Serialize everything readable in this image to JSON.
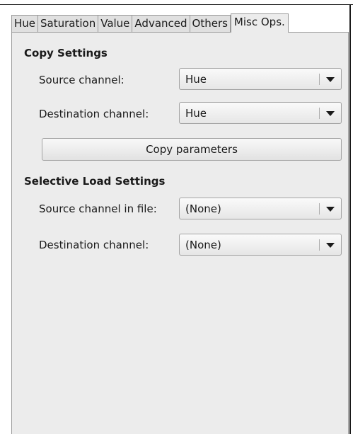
{
  "tabs": [
    {
      "label": "Hue",
      "active": false
    },
    {
      "label": "Saturation",
      "active": false
    },
    {
      "label": "Value",
      "active": false
    },
    {
      "label": "Advanced",
      "active": false
    },
    {
      "label": "Others",
      "active": false
    },
    {
      "label": "Misc Ops.",
      "active": true
    }
  ],
  "copy_settings": {
    "title": "Copy Settings",
    "source_label": "Source channel:",
    "source_value": "Hue",
    "destination_label": "Destination channel:",
    "destination_value": "Hue",
    "copy_button": "Copy parameters"
  },
  "selective_load": {
    "title": "Selective Load Settings",
    "source_label": "Source channel in file:",
    "source_value": "(None)",
    "destination_label": "Destination channel:",
    "destination_value": "(None)"
  }
}
